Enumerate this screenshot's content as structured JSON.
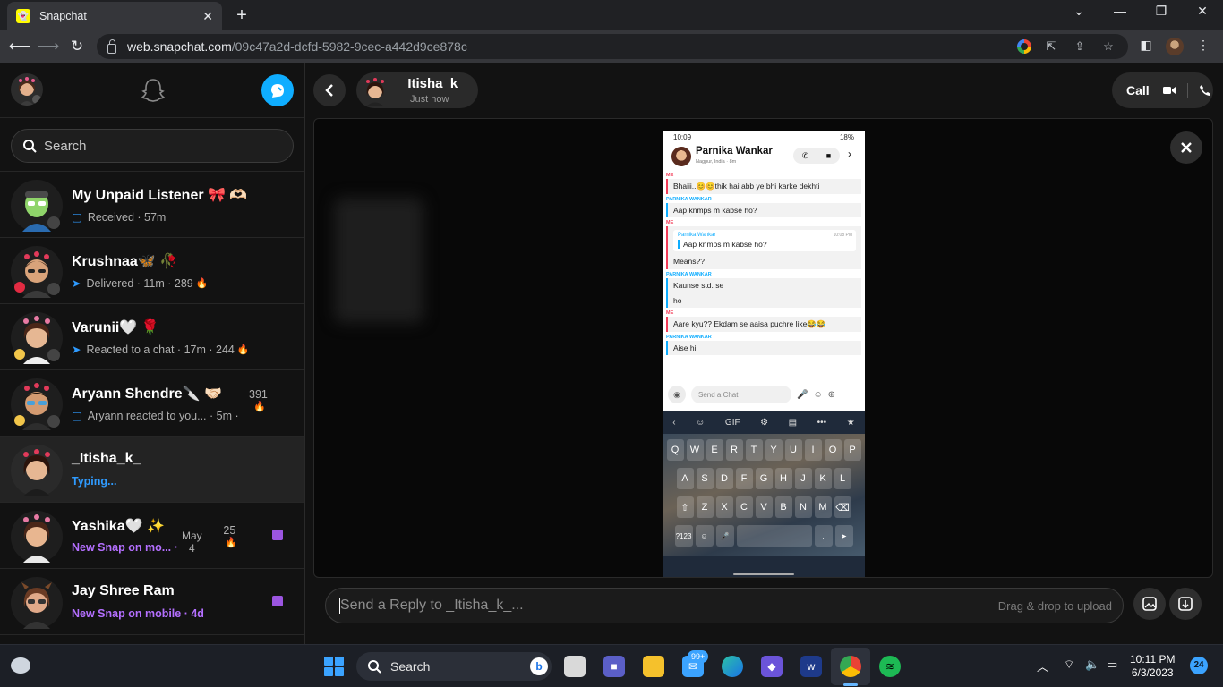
{
  "browser": {
    "tab_title": "Snapchat",
    "tab_close": "✕",
    "new_tab": "+",
    "url_domain": "web.snapchat.com",
    "url_path": "/09c47a2d-dcfd-5982-9cec-a442d9ce878c",
    "window_controls": [
      "⌄",
      "—",
      "❐",
      "✕"
    ]
  },
  "sidebar": {
    "search_placeholder": "Search",
    "chats": [
      {
        "name": "My Unpaid Listener 🎀 🫶🏻",
        "status": "Received · 57m",
        "status_icon": "received-icon",
        "icon_glyph": "▢",
        "icon_color": "#2f9bff"
      },
      {
        "name": "Krushnaa🦋 🥀",
        "status": "Delivered · 11m · 289",
        "status_icon": "delivered-icon",
        "icon_glyph": "➤",
        "icon_color": "#2f9bff",
        "fire": "🔥"
      },
      {
        "name": "Varunii🤍 🌹",
        "status": "Reacted to a chat · 17m · 244",
        "status_icon": "delivered-icon",
        "icon_glyph": "➤",
        "icon_color": "#2f9bff",
        "fire": "🔥"
      },
      {
        "name": "Aryann Shendre🔪 🤝🏻",
        "status": "Aryann reacted to you... · 5m ·",
        "status_icon": "received-icon",
        "icon_glyph": "▢",
        "icon_color": "#2f9bff",
        "streak": "391",
        "fire": "🔥"
      },
      {
        "name": "_Itisha_k_",
        "status": "Typing...",
        "status_color": "#2f9bff"
      },
      {
        "name": "Yashika🤍 ✨",
        "status": "New Snap on mo... ·",
        "status_color": "#b46fff",
        "date_line1": "May",
        "date_line2": "4",
        "streak": "25",
        "fire": "🔥",
        "has_snap": true
      },
      {
        "name": "Jay Shree Ram",
        "status": "New Snap on mobile · 4d",
        "status_color": "#b46fff",
        "has_snap": true
      }
    ]
  },
  "conversation": {
    "friend_name": "_Itisha_k_",
    "friend_sub": "Just now",
    "call_label": "Call",
    "reply_placeholder": "Send a Reply to _Itisha_k_...",
    "drag_drop": "Drag & drop to upload"
  },
  "phone": {
    "time": "10:09",
    "battery": "18%",
    "contact_name": "Parnika Wankar",
    "contact_loc": "Nagpur, India · 8m",
    "messages": [
      {
        "sender": "ME",
        "text": "Bhaiii..😊😊thik hai abb ye bhi karke dekhti"
      },
      {
        "sender": "PARNIKA WANKAR",
        "text": "Aap knmps m kabse ho?"
      },
      {
        "sender": "ME",
        "quote_name": "Parnika Wankar",
        "quote_time": "10:08 PM",
        "quote_text": "Aap knmps m kabse ho?",
        "text": "Means??"
      },
      {
        "sender": "PARNIKA WANKAR",
        "text": "Kaunse std. se",
        "text2": "ho"
      },
      {
        "sender": "ME",
        "text": "Aare kyu?? Ekdam se aaisa puchre like😂😂"
      },
      {
        "sender": "PARNIKA WANKAR",
        "text": "Aise hi"
      }
    ],
    "send_placeholder": "Send a Chat",
    "keyboard_row1": [
      "Q",
      "W",
      "E",
      "R",
      "T",
      "Y",
      "U",
      "I",
      "O",
      "P"
    ],
    "keyboard_row2": [
      "A",
      "S",
      "D",
      "F",
      "G",
      "H",
      "J",
      "K",
      "L"
    ],
    "keyboard_row3": [
      "⇧",
      "Z",
      "X",
      "C",
      "V",
      "B",
      "N",
      "M",
      "⌫"
    ],
    "keyboard_row4": [
      "?123",
      "☺",
      "🎤",
      "",
      ".",
      " ➤"
    ]
  },
  "taskbar": {
    "search_label": "Search",
    "badge": "99+",
    "time": "10:11 PM",
    "date": "6/3/2023",
    "notification_count": "24"
  }
}
